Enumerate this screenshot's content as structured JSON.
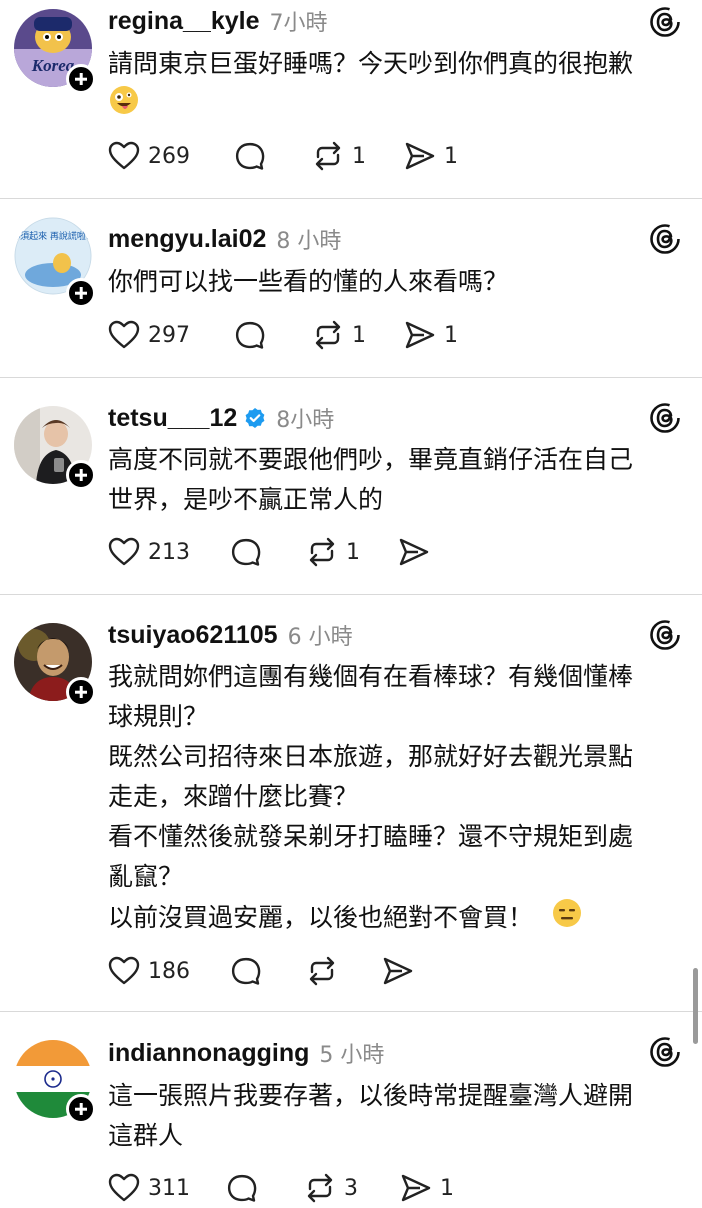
{
  "posts": [
    {
      "username": "regina__kyle",
      "time": "7小時",
      "lines": [
        "請問東京巨蛋好睡嗎？今天吵到你們真的很抱歉"
      ],
      "emoji": "zany-face",
      "likes": "269",
      "reposts": "1",
      "shares": "1"
    },
    {
      "username": "mengyu.lai02",
      "time": "8 小時",
      "lines": [
        "你們可以找一些看的懂的人來看嗎？"
      ],
      "likes": "297",
      "reposts": "1",
      "shares": "1"
    },
    {
      "username": "tetsu___12",
      "verified": true,
      "time": "8小時",
      "lines": [
        "高度不同就不要跟他們吵，畢竟直銷仔活在自己",
        "世界，是吵不贏正常人的"
      ],
      "likes": "213",
      "reposts": "1"
    },
    {
      "username": "tsuiyao621105",
      "time": "6 小時",
      "lines": [
        "我就問妳們這團有幾個有在看棒球？有幾個懂棒",
        "球規則？",
        "既然公司招待來日本旅遊，那就好好去觀光景點",
        "走走，來蹭什麼比賽？",
        "看不懂然後就發呆剃牙打瞌睡？還不守規矩到處",
        "亂竄？",
        "以前沒買過安麗，以後也絕對不會買！"
      ],
      "emoji": "expressionless-face",
      "likes": "186"
    },
    {
      "username": "indiannonagging",
      "time": "5 小時",
      "lines": [
        "這一張照片我要存著，以後時常提醒臺灣人避開",
        "這群人"
      ],
      "likes": "311",
      "reposts": "3",
      "shares": "1"
    }
  ],
  "avatar_badges": {
    "regina": "Korea",
    "mengyu": "必須起來 再說謊啦！"
  },
  "icons": [
    "heart-icon",
    "comment-icon",
    "repost-icon",
    "share-icon",
    "threads-logo-icon",
    "follow-plus-icon",
    "verified-badge-icon"
  ],
  "colors": {
    "text": "#111111",
    "muted": "#8a8a8a",
    "divider": "#d9d9d9",
    "verified": "#1d9bf0"
  }
}
